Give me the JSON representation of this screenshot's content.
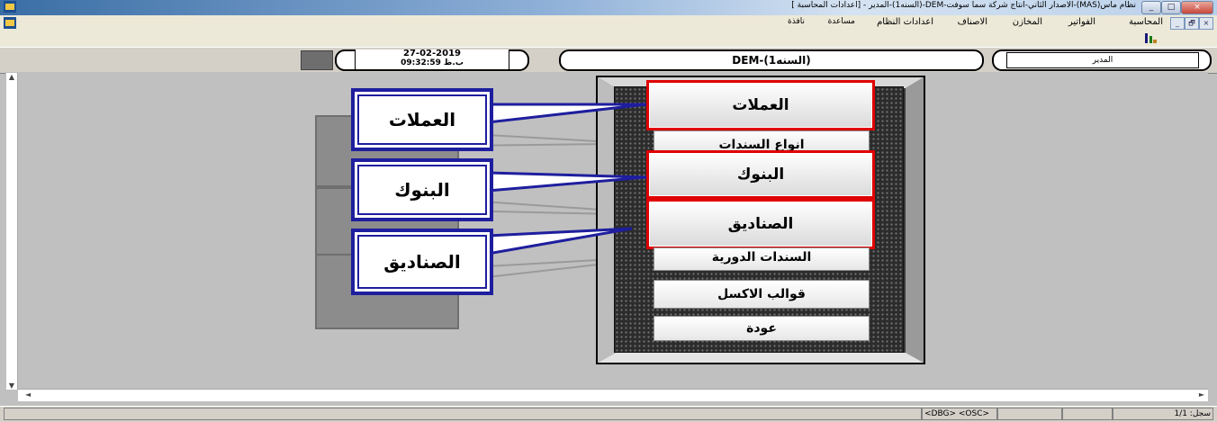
{
  "window": {
    "title": "نظام ماس(MAS)-الاصدار الثاني-انتاج شركة سما سوفت-DEM-(السنه1)-المدير - [اعدادات المحاسبة ]",
    "controls": [
      "_",
      "□",
      "×"
    ],
    "mdi_controls": [
      "×",
      "🗗",
      "_"
    ]
  },
  "menu": {
    "items": [
      "المحاسبة",
      "الفواتير",
      "المخازن",
      "الاصناف",
      "اعدادات النظام",
      "مساعدة",
      "نافذة"
    ]
  },
  "header": {
    "user": "المدير",
    "company": "DEM-(السنه1)",
    "date": "27-02-2019",
    "time": "09:32:59 ب.ظ"
  },
  "menu_panel": {
    "buttons": [
      "العملات",
      "انواع السندات",
      "البنوك",
      "الصناديق",
      "السندات الدورية",
      "قوالب الاكسل",
      "عودة"
    ]
  },
  "callouts": [
    "العملات",
    "البنوك",
    "الصناديق"
  ],
  "statusbar": {
    "tags": "<DBG> <OSC>",
    "record": "سجل: 1/1"
  },
  "colors": {
    "highlight": "#e00000",
    "callout_border": "#1e1e9e",
    "panel_bg": "#2c2c2c",
    "workspace_bg": "#c0c0c0"
  }
}
